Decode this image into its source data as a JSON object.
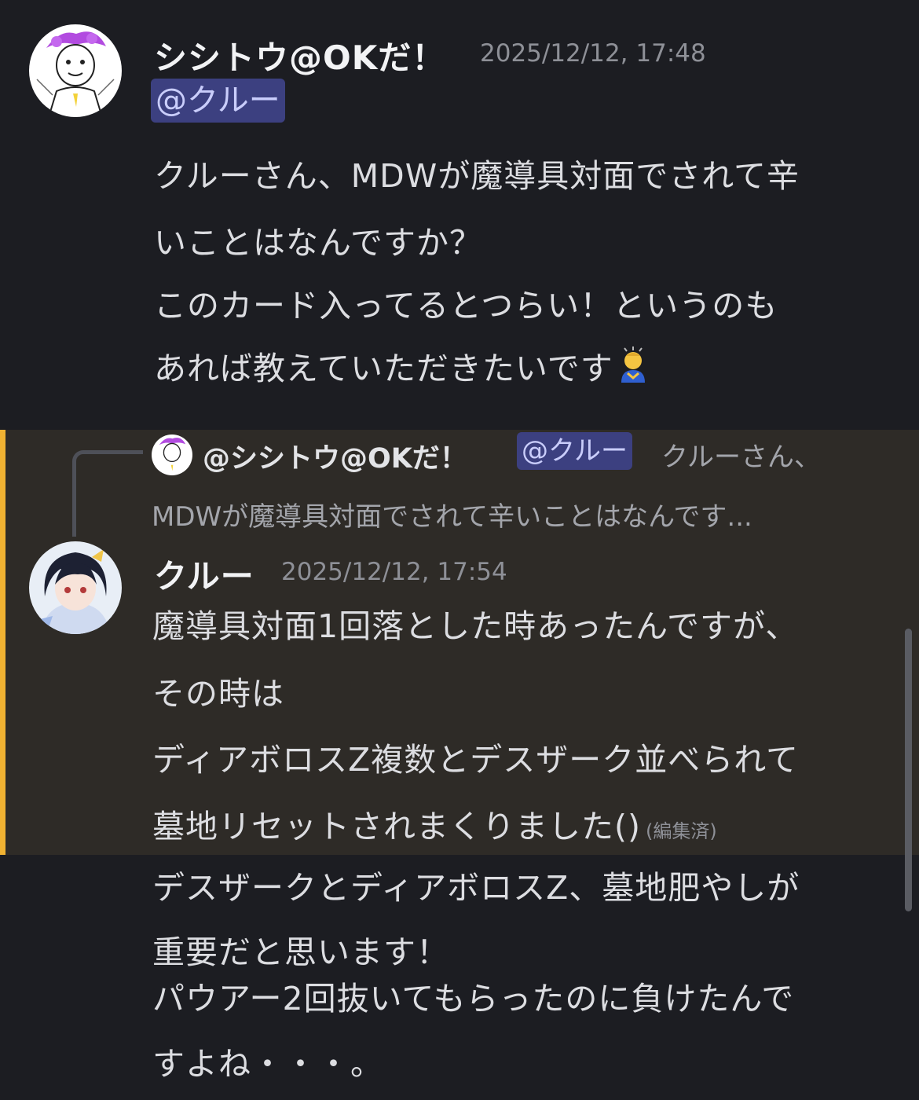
{
  "messages": [
    {
      "author": "シシトウ@OKだ！",
      "timestamp": "2025/12/12, 17:48",
      "mention": "@クルー",
      "lines": [
        "クルーさん、MDWが魔導具対面でされて辛",
        "いことはなんですか？",
        "このカード入ってるとつらい！というのも",
        "あれば教えていただきたいです"
      ],
      "trailing_emoji": "bowing-person-emoji"
    },
    {
      "reply": {
        "author": "@シシトウ@OKだ！",
        "mention": "@クルー",
        "preview_inline": "クルーさん、",
        "preview_line2": "MDWが魔導具対面でされて辛いことはなんです..."
      },
      "author": "クルー",
      "timestamp": "2025/12/12, 17:54",
      "lines": [
        "魔導具対面1回落とした時あったんですが、",
        "その時は",
        "ディアボロスZ複数とデスザーク並べられて",
        "墓地リセットされまくりました()"
      ],
      "edited_label": "(編集済)"
    },
    {
      "lines": [
        "デスザークとディアボロスZ、墓地肥やしが",
        "重要だと思います！",
        "パウアー2回抜いてもらったのに負けたんで",
        "すよね・・・。"
      ]
    }
  ],
  "colors": {
    "background": "#1c1d22",
    "highlight_background": "#2e2b27",
    "highlight_bar": "#f0b232",
    "mention_background": "#3c4080",
    "mention_text": "#c9cdfb"
  }
}
